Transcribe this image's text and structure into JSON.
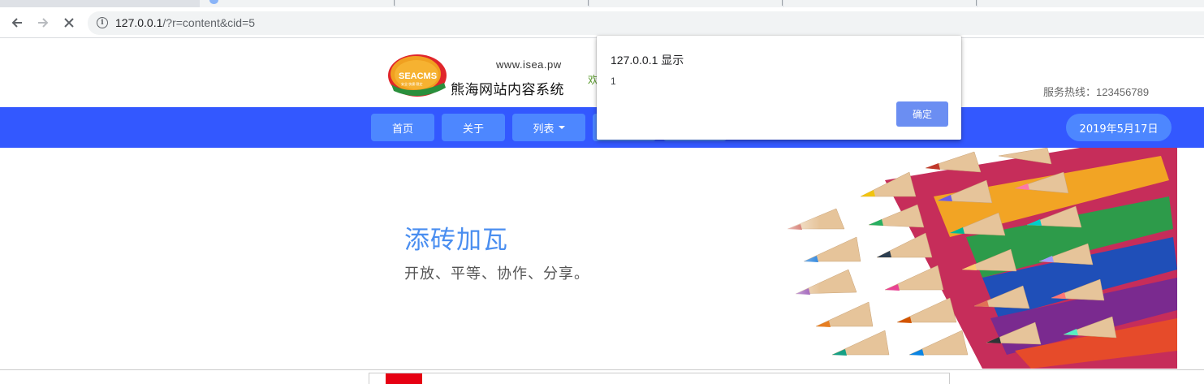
{
  "browser": {
    "url_host": "127.0.0.1",
    "url_path": "/?r=content&cid=5",
    "back_icon": "arrow-left-icon",
    "forward_icon": "arrow-right-icon",
    "stop_icon": "close-icon",
    "info_icon": "info-icon",
    "info_glyph": "i"
  },
  "header": {
    "logo_text": "SEACMS",
    "logo_slogan": "安全·快捷·稳定",
    "domain": "www.isea.pw",
    "site_name": "熊海网站内容系统",
    "welcome": "欢",
    "hotline": "服务热线：123456789"
  },
  "nav": {
    "items": [
      {
        "label": "首页"
      },
      {
        "label": "关于"
      },
      {
        "label": "列表"
      },
      {
        "label": ""
      },
      {
        "label": ""
      }
    ],
    "date": "2019年5月17日"
  },
  "hero": {
    "title": "添砖加瓦",
    "subtitle": "开放、平等、协作、分享。"
  },
  "dialog": {
    "title": "127.0.0.1 显示",
    "message": "1",
    "ok_label": "确定"
  },
  "colors": {
    "navbar": "#3358ff",
    "nav_button": "#4d87ff",
    "hero_title": "#4a8ef0",
    "dialog_button": "#6b8ef2"
  }
}
